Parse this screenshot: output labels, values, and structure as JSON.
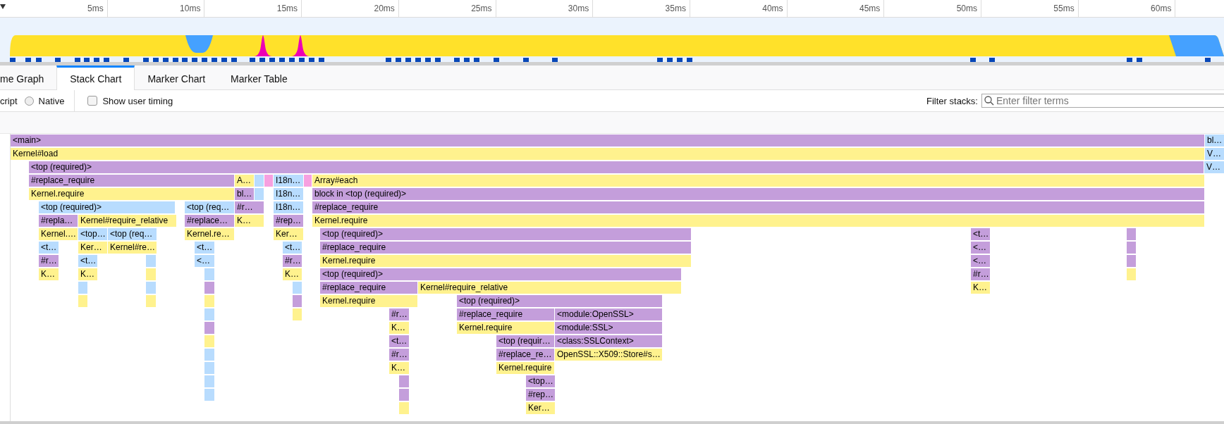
{
  "timeline": {
    "ticks": [
      "5ms",
      "10ms",
      "15ms",
      "20ms",
      "25ms",
      "30ms",
      "35ms",
      "40ms",
      "45ms",
      "50ms",
      "55ms",
      "60ms"
    ]
  },
  "tabs": [
    {
      "label": "me Graph",
      "selected": false
    },
    {
      "label": "Stack Chart",
      "selected": true
    },
    {
      "label": "Marker Chart",
      "selected": false
    },
    {
      "label": "Marker Table",
      "selected": false
    }
  ],
  "toolbar": {
    "cut_label": "cript",
    "native_radio": {
      "label": "Native",
      "selected": false
    },
    "user_timing_checkbox": {
      "label": "Show user timing",
      "checked": false
    },
    "filter_label": "Filter stacks:",
    "filter": {
      "placeholder": "Enter filter terms"
    }
  },
  "stack_chart": {
    "rows": [
      {
        "frames": [
          {
            "label": "<main>",
            "color": "#c49edb"
          },
          {
            "label": "bl…",
            "color": "#b8dcfe"
          }
        ]
      },
      {
        "frames": [
          {
            "label": "Kernel#load",
            "color": "#fff28e"
          },
          {
            "label": "V…",
            "color": "#b8dcfe"
          }
        ]
      },
      {
        "frames": [
          {
            "label": "<top (required)>",
            "color": "#c49edb"
          },
          {
            "label": "V…",
            "color": "#b8dcfe"
          }
        ]
      },
      {
        "frames": [
          {
            "label": "#replace_require",
            "color": "#c49edb"
          },
          {
            "label": "A…",
            "color": "#fff28e"
          },
          {
            "color": "#b8dcfe"
          },
          {
            "color": "#f6a0e0"
          },
          {
            "label": "I18n…",
            "color": "#b8dcfe"
          },
          {
            "color": "#f6a0e0"
          },
          {
            "label": "Array#each",
            "color": "#fff28e"
          }
        ]
      },
      {
        "frames": [
          {
            "label": "Kernel.require",
            "color": "#fff28e"
          },
          {
            "label": "bl…",
            "color": "#c49edb"
          },
          {
            "color": "#b8dcfe"
          },
          {
            "label": "I18n…",
            "color": "#b8dcfe"
          },
          {
            "label": "block in <top (required)>",
            "color": "#c49edb"
          }
        ]
      },
      {
        "frames": [
          {
            "label": "<top (required)>",
            "color": "#b8dcfe"
          },
          {
            "label": "<top (req…",
            "color": "#b8dcfe"
          },
          {
            "label": "#r…",
            "color": "#c49edb"
          },
          {
            "color": "#c49edb"
          },
          {
            "label": "I18n…",
            "color": "#b8dcfe"
          },
          {
            "label": "#replace_require",
            "color": "#c49edb"
          }
        ]
      },
      {
        "frames": [
          {
            "label": "#repla…",
            "color": "#c49edb"
          },
          {
            "label": "Kernel#require_relative",
            "color": "#fff28e"
          },
          {
            "label": "#replace…",
            "color": "#c49edb"
          },
          {
            "label": "K…",
            "color": "#fff28e"
          },
          {
            "color": "#fff28e"
          },
          {
            "label": "#rep…",
            "color": "#c49edb"
          },
          {
            "label": "Kernel.require",
            "color": "#fff28e"
          }
        ]
      },
      {
        "frames": [
          {
            "label": "Kernel.…",
            "color": "#fff28e"
          },
          {
            "label": "<top…",
            "color": "#b8dcfe"
          },
          {
            "label": "<top (req…",
            "color": "#b8dcfe"
          },
          {
            "label": "Kernel.re…",
            "color": "#fff28e"
          },
          {
            "label": "Ker…",
            "color": "#fff28e"
          },
          {
            "label": "<top (required)>",
            "color": "#c49edb"
          },
          {
            "label": "<t…",
            "color": "#c49edb"
          },
          {
            "color": "#c49edb"
          }
        ]
      },
      {
        "frames": [
          {
            "label": "<t…",
            "color": "#b8dcfe"
          },
          {
            "label": "Ker…",
            "color": "#fff28e"
          },
          {
            "label": "Kernel#re…",
            "color": "#fff28e"
          },
          {
            "label": "<t…",
            "color": "#b8dcfe"
          },
          {
            "label": "<t…",
            "color": "#b8dcfe"
          },
          {
            "label": "#replace_require",
            "color": "#c49edb"
          },
          {
            "label": "<…",
            "color": "#c49edb"
          },
          {
            "color": "#c49edb"
          }
        ]
      },
      {
        "frames": [
          {
            "label": "#r…",
            "color": "#c49edb"
          },
          {
            "label": "<t…",
            "color": "#b8dcfe"
          },
          {
            "color": "#b8dcfe"
          },
          {
            "label": "<…",
            "color": "#b8dcfe"
          },
          {
            "label": "#r…",
            "color": "#c49edb"
          },
          {
            "label": "Kernel.require",
            "color": "#fff28e"
          },
          {
            "label": "<…",
            "color": "#c49edb"
          },
          {
            "color": "#c49edb"
          }
        ]
      },
      {
        "frames": [
          {
            "label": "K…",
            "color": "#fff28e"
          },
          {
            "label": "K…",
            "color": "#fff28e"
          },
          {
            "color": "#fff28e"
          },
          {
            "color": "#b8dcfe"
          },
          {
            "label": "K…",
            "color": "#fff28e"
          },
          {
            "label": "<top (required)>",
            "color": "#c49edb"
          },
          {
            "label": "#r…",
            "color": "#c49edb"
          },
          {
            "color": "#fff28e"
          }
        ]
      },
      {
        "frames": [
          {
            "color": "#b8dcfe"
          },
          {
            "color": "#b8dcfe"
          },
          {
            "color": "#c49edb"
          },
          {
            "color": "#b8dcfe"
          },
          {
            "label": "#replace_require",
            "color": "#c49edb"
          },
          {
            "label": "Kernel#require_relative",
            "color": "#fff28e"
          },
          {
            "label": "K…",
            "color": "#fff28e"
          }
        ]
      },
      {
        "frames": [
          {
            "color": "#fff28e"
          },
          {
            "color": "#fff28e"
          },
          {
            "color": "#fff28e"
          },
          {
            "color": "#c49edb"
          },
          {
            "label": "Kernel.require",
            "color": "#fff28e"
          },
          {
            "label": "<top (required)>",
            "color": "#c49edb"
          }
        ]
      },
      {
        "frames": [
          {
            "color": "#b8dcfe"
          },
          {
            "color": "#fff28e"
          },
          {
            "label": "#r…",
            "color": "#c49edb"
          },
          {
            "label": "#replace_require",
            "color": "#c49edb"
          },
          {
            "label": "<module:OpenSSL>",
            "color": "#c49edb"
          }
        ]
      },
      {
        "frames": [
          {
            "color": "#c49edb"
          },
          {
            "label": "K…",
            "color": "#fff28e"
          },
          {
            "label": "Kernel.require",
            "color": "#fff28e"
          },
          {
            "label": "<module:SSL>",
            "color": "#c49edb"
          }
        ]
      },
      {
        "frames": [
          {
            "color": "#fff28e"
          },
          {
            "label": "<t…",
            "color": "#c49edb"
          },
          {
            "label": "<top (requir…",
            "color": "#c49edb"
          },
          {
            "label": "<class:SSLContext>",
            "color": "#c49edb"
          }
        ]
      },
      {
        "frames": [
          {
            "color": "#b8dcfe"
          },
          {
            "label": "#r…",
            "color": "#c49edb"
          },
          {
            "label": "#replace_re…",
            "color": "#c49edb"
          },
          {
            "label": "OpenSSL::X509::Store#s…",
            "color": "#fff28e"
          }
        ]
      },
      {
        "frames": [
          {
            "color": "#b8dcfe"
          },
          {
            "label": "K…",
            "color": "#fff28e"
          },
          {
            "label": "Kernel.require",
            "color": "#fff28e"
          }
        ]
      },
      {
        "frames": [
          {
            "color": "#b8dcfe"
          },
          {
            "color": "#c49edb"
          },
          {
            "label": "<top…",
            "color": "#c49edb"
          }
        ]
      },
      {
        "frames": [
          {
            "color": "#b8dcfe"
          },
          {
            "color": "#c49edb"
          },
          {
            "label": "#rep…",
            "color": "#c49edb"
          }
        ]
      },
      {
        "frames": [
          {
            "color": "#fff28e"
          },
          {
            "label": "Ker…",
            "color": "#fff28e"
          }
        ]
      }
    ]
  }
}
